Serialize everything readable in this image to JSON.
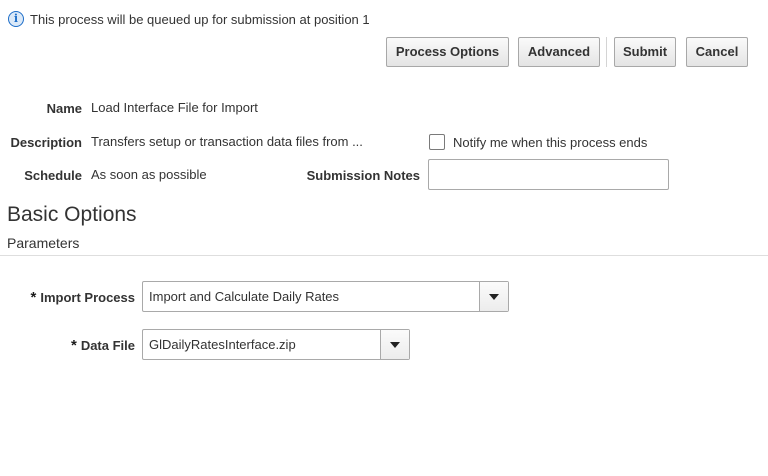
{
  "info": {
    "icon": "info-icon",
    "message": "This process will be queued up for submission at position 1"
  },
  "toolbar": {
    "process_options": "Process Options",
    "advanced": "Advanced",
    "submit": "Submit",
    "cancel": "Cancel"
  },
  "details": {
    "name_label": "Name",
    "name_value": "Load Interface File for Import",
    "description_label": "Description",
    "description_value": "Transfers setup or transaction data files from ...",
    "schedule_label": "Schedule",
    "schedule_value": "As soon as possible",
    "notify_label": "Notify me when this process ends",
    "notify_checked": false,
    "submission_notes_label": "Submission Notes",
    "submission_notes_value": ""
  },
  "section": {
    "title": "Basic Options",
    "subtitle": "Parameters"
  },
  "parameters": {
    "required_marker": "*",
    "import_process_label": "Import Process",
    "import_process_value": "Import and Calculate Daily Rates",
    "data_file_label": "Data File",
    "data_file_value": "GlDailyRatesInterface.zip"
  }
}
